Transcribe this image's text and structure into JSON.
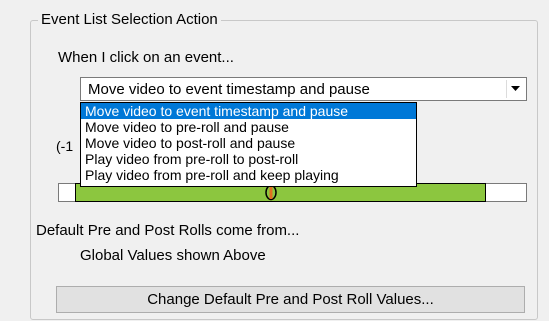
{
  "group": {
    "title": "Event List Selection Action"
  },
  "event_click": {
    "prompt": "When I click on an event...",
    "selected": "Move video to event timestamp and pause",
    "options": [
      "Move video to event timestamp and pause",
      "Move video to pre-roll and pause",
      "Move video to post-roll and pause",
      "Play video from pre-roll to post-roll",
      "Play video from pre-roll and keep playing"
    ]
  },
  "obscured_label_fragment": "(-1",
  "defaults": {
    "label": "Default Pre and Post Rolls come from...",
    "value": "Global Values shown Above"
  },
  "change_button": {
    "label": "Change Default Pre and Post Roll Values..."
  },
  "colors": {
    "selection": "#0078d7",
    "timeline_fill": "#8cc63f",
    "marker": "#e07020",
    "panel": "#f0f0f0"
  },
  "icons": {
    "combo_arrow": "chevron-down-icon",
    "timeline_marker": "timestamp-marker-icon"
  }
}
